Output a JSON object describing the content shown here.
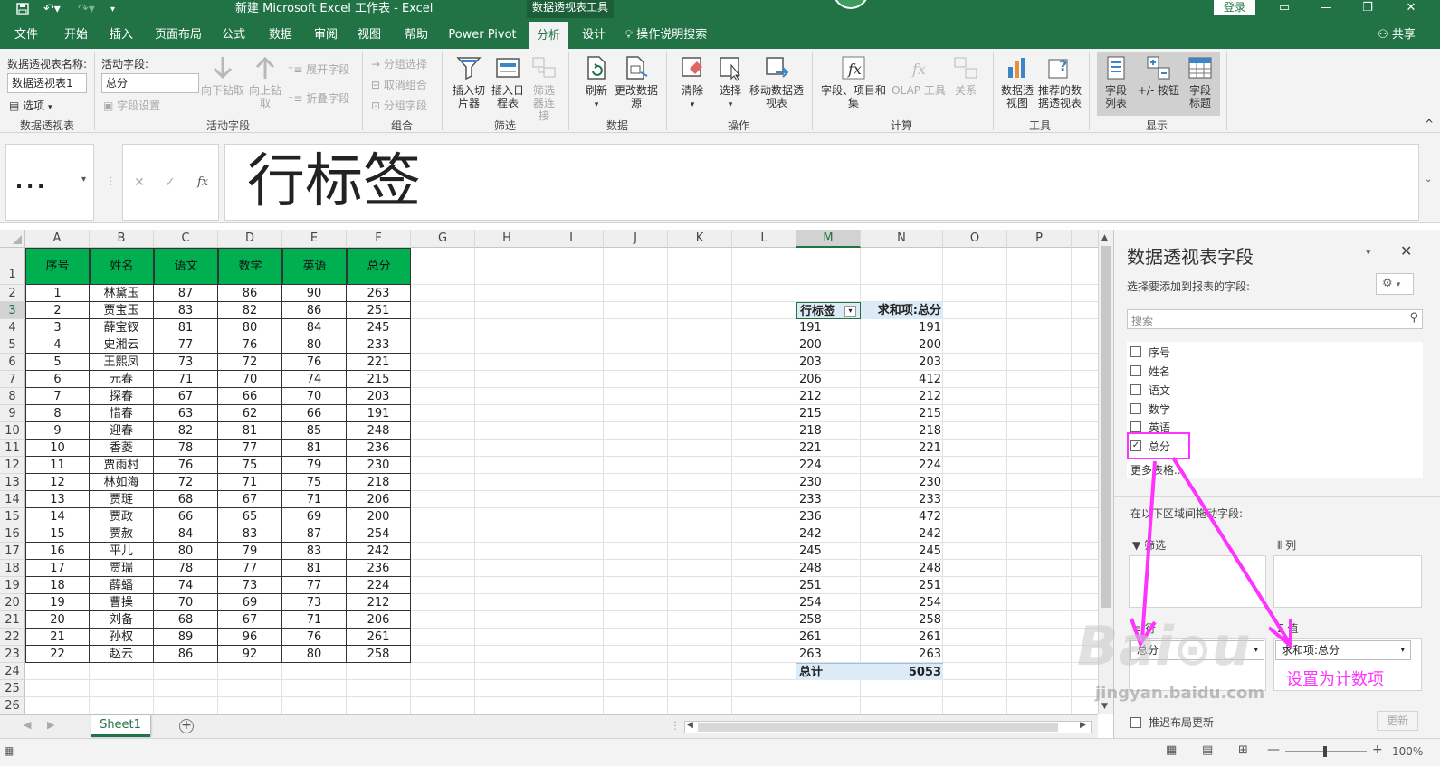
{
  "titlebar": {
    "title": "新建 Microsoft Excel 工作表  -  Excel",
    "context_tool": "数据透视表工具",
    "login": "登录"
  },
  "tabs": [
    "文件",
    "开始",
    "插入",
    "页面布局",
    "公式",
    "数据",
    "审阅",
    "视图",
    "帮助",
    "Power Pivot",
    "分析",
    "设计",
    "操作说明搜索",
    "共享"
  ],
  "ribbon": {
    "pivot_name_label": "数据透视表名称:",
    "pivot_name_value": "数据透视表1",
    "options": "选项",
    "group_pivot": "数据透视表",
    "active_field_label": "活动字段:",
    "active_field_value": "总分",
    "field_settings": "字段设置",
    "drill_down": "向下钻取",
    "drill_up": "向上钻取",
    "expand_field": "展开字段",
    "collapse_field": "折叠字段",
    "group_active_field": "活动字段",
    "group_selection": "分组选择",
    "ungroup": "取消组合",
    "group_field": "分组字段",
    "group_group": "组合",
    "insert_slicer": "插入切片器",
    "insert_timeline": "插入日程表",
    "filter_connections": "筛选器连接",
    "group_filter": "筛选",
    "refresh": "刷新",
    "change_source": "更改数据源",
    "group_data": "数据",
    "clear": "清除",
    "select": "选择",
    "move_pivot": "移动数据透视表",
    "group_actions": "操作",
    "fields_items": "字段、项目和集",
    "olap_tools": "OLAP 工具",
    "relationships": "关系",
    "group_calc": "计算",
    "pivot_chart": "数据透视图",
    "recommended": "推荐的数据透视表",
    "group_tools": "工具",
    "field_list": "字段列表",
    "buttons": "+/- 按钮",
    "field_headers": "字段标题",
    "group_show": "显示"
  },
  "formula_bar": {
    "name_box": "...",
    "content": "行标签"
  },
  "columns": [
    "A",
    "B",
    "C",
    "D",
    "E",
    "F",
    "G",
    "H",
    "I",
    "J",
    "K",
    "L",
    "M",
    "N",
    "O",
    "P"
  ],
  "table": {
    "headers": [
      "序号",
      "姓名",
      "语文",
      "数学",
      "英语",
      "总分"
    ],
    "rows": [
      [
        "1",
        "林黛玉",
        "87",
        "86",
        "90",
        "263"
      ],
      [
        "2",
        "贾宝玉",
        "83",
        "82",
        "86",
        "251"
      ],
      [
        "3",
        "薛宝钗",
        "81",
        "80",
        "84",
        "245"
      ],
      [
        "4",
        "史湘云",
        "77",
        "76",
        "80",
        "233"
      ],
      [
        "5",
        "王熙凤",
        "73",
        "72",
        "76",
        "221"
      ],
      [
        "6",
        "元春",
        "71",
        "70",
        "74",
        "215"
      ],
      [
        "7",
        "探春",
        "67",
        "66",
        "70",
        "203"
      ],
      [
        "8",
        "惜春",
        "63",
        "62",
        "66",
        "191"
      ],
      [
        "9",
        "迎春",
        "82",
        "81",
        "85",
        "248"
      ],
      [
        "10",
        "香菱",
        "78",
        "77",
        "81",
        "236"
      ],
      [
        "11",
        "贾雨村",
        "76",
        "75",
        "79",
        "230"
      ],
      [
        "12",
        "林如海",
        "72",
        "71",
        "75",
        "218"
      ],
      [
        "13",
        "贾琏",
        "68",
        "67",
        "71",
        "206"
      ],
      [
        "14",
        "贾政",
        "66",
        "65",
        "69",
        "200"
      ],
      [
        "15",
        "贾赦",
        "84",
        "83",
        "87",
        "254"
      ],
      [
        "16",
        "平儿",
        "80",
        "79",
        "83",
        "242"
      ],
      [
        "17",
        "贾瑞",
        "78",
        "77",
        "81",
        "236"
      ],
      [
        "18",
        "薛蟠",
        "74",
        "73",
        "77",
        "224"
      ],
      [
        "19",
        "曹操",
        "70",
        "69",
        "73",
        "212"
      ],
      [
        "20",
        "刘备",
        "68",
        "67",
        "71",
        "206"
      ],
      [
        "21",
        "孙权",
        "89",
        "96",
        "76",
        "261"
      ],
      [
        "22",
        "赵云",
        "86",
        "92",
        "80",
        "258"
      ]
    ]
  },
  "pivot": {
    "row_label": "行标签",
    "sum_label": "求和项:总分",
    "rows": [
      [
        "191",
        "191"
      ],
      [
        "200",
        "200"
      ],
      [
        "203",
        "203"
      ],
      [
        "206",
        "412"
      ],
      [
        "212",
        "212"
      ],
      [
        "215",
        "215"
      ],
      [
        "218",
        "218"
      ],
      [
        "221",
        "221"
      ],
      [
        "224",
        "224"
      ],
      [
        "230",
        "230"
      ],
      [
        "233",
        "233"
      ],
      [
        "236",
        "472"
      ],
      [
        "242",
        "242"
      ],
      [
        "245",
        "245"
      ],
      [
        "248",
        "248"
      ],
      [
        "251",
        "251"
      ],
      [
        "254",
        "254"
      ],
      [
        "258",
        "258"
      ],
      [
        "261",
        "261"
      ],
      [
        "263",
        "263"
      ]
    ],
    "total_label": "总计",
    "total_value": "5053"
  },
  "sheet_tab": "Sheet1",
  "panel": {
    "title": "数据透视表字段",
    "subtitle": "选择要添加到报表的字段:",
    "search_placeholder": "搜索",
    "fields": [
      "序号",
      "姓名",
      "语文",
      "数学",
      "英语",
      "总分"
    ],
    "more_tables": "更多表格...",
    "drag_hint": "在以下区域间拖动字段:",
    "filter_area": "筛选",
    "column_area": "列",
    "row_area": "行",
    "value_area": "值",
    "row_item": "总分",
    "value_item": "求和项:总分",
    "defer_update": "推迟布局更新",
    "update_button": "更新"
  },
  "annotation": "设置为计数项",
  "status": {
    "zoom": "100%"
  },
  "colors": {
    "excel_green": "#217346",
    "header_fill": "#00b050",
    "annotation": "#ff33ff"
  }
}
